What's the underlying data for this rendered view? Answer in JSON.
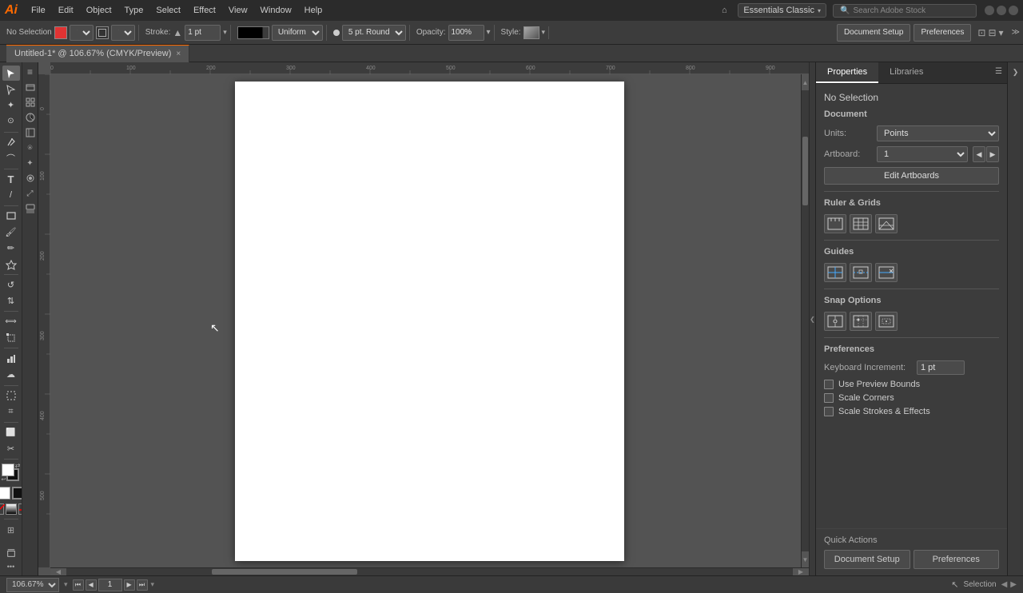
{
  "app": {
    "logo": "Ai",
    "title": "Untitled-1* @ 106.67% (CMYK/Preview)"
  },
  "menu": {
    "items": [
      "File",
      "Edit",
      "Object",
      "Type",
      "Select",
      "Effect",
      "View",
      "Window",
      "Help"
    ]
  },
  "workspace": {
    "label": "Essentials Classic",
    "chevron": "▾"
  },
  "search": {
    "placeholder": "Search Adobe Stock"
  },
  "toolbar": {
    "selection_label": "No Selection",
    "stroke_label": "Stroke:",
    "stroke_value": "1 pt",
    "stroke_type": "Uniform",
    "brush_size": "5 pt. Round",
    "opacity_label": "Opacity:",
    "opacity_value": "100%",
    "style_label": "Style:",
    "doc_setup_btn": "Document Setup",
    "preferences_btn": "Preferences"
  },
  "tabs": {
    "active": {
      "label": "Untitled-1* @ 106.67% (CMYK/Preview)",
      "close": "×"
    }
  },
  "properties_panel": {
    "tab_properties": "Properties",
    "tab_libraries": "Libraries",
    "no_selection": "No Selection",
    "section_document": "Document",
    "units_label": "Units:",
    "units_value": "Points",
    "artboard_label": "Artboard:",
    "artboard_value": "1",
    "edit_artboards_btn": "Edit Artboards",
    "section_ruler": "Ruler & Grids",
    "section_guides": "Guides",
    "section_snap": "Snap Options",
    "section_preferences": "Preferences",
    "keyboard_increment_label": "Keyboard Increment:",
    "keyboard_increment_value": "1 pt",
    "use_preview_bounds_label": "Use Preview Bounds",
    "scale_corners_label": "Scale Corners",
    "scale_strokes_label": "Scale Strokes & Effects",
    "quick_actions_title": "Quick Actions",
    "doc_setup_btn": "Document Setup",
    "preferences_btn": "Preferences"
  },
  "status_bar": {
    "zoom": "106.67%",
    "page": "1",
    "tool_label": "Selection"
  },
  "tools": [
    {
      "name": "selection-tool",
      "icon": "↖",
      "active": true
    },
    {
      "name": "direct-select-tool",
      "icon": "↖"
    },
    {
      "name": "magic-wand-tool",
      "icon": "✦"
    },
    {
      "name": "lasso-tool",
      "icon": "⊙"
    },
    {
      "name": "pen-tool",
      "icon": "✒"
    },
    {
      "name": "curvature-tool",
      "icon": "~"
    },
    {
      "name": "type-tool",
      "icon": "T"
    },
    {
      "name": "line-tool",
      "icon": "/"
    },
    {
      "name": "rectangle-tool",
      "icon": "□"
    },
    {
      "name": "paintbrush-tool",
      "icon": "⌒"
    },
    {
      "name": "pencil-tool",
      "icon": "✏"
    },
    {
      "name": "shaper-tool",
      "icon": "◻"
    },
    {
      "name": "rotate-tool",
      "icon": "↺"
    },
    {
      "name": "reflect-tool",
      "icon": "⇅"
    },
    {
      "name": "scale-tool",
      "icon": "⤢"
    },
    {
      "name": "width-tool",
      "icon": "⟺"
    },
    {
      "name": "free-transform-tool",
      "icon": "⊞"
    },
    {
      "name": "graph-tool",
      "icon": "▦"
    },
    {
      "name": "symbol-sprayer-tool",
      "icon": "☁"
    },
    {
      "name": "artboard-tool",
      "icon": "⊡"
    },
    {
      "name": "slice-tool",
      "icon": "⌗"
    },
    {
      "name": "eraser-tool",
      "icon": "⬜"
    },
    {
      "name": "scissors-tool",
      "icon": "✂"
    },
    {
      "name": "hand-tool",
      "icon": "✋"
    },
    {
      "name": "zoom-tool",
      "icon": "🔍"
    }
  ]
}
